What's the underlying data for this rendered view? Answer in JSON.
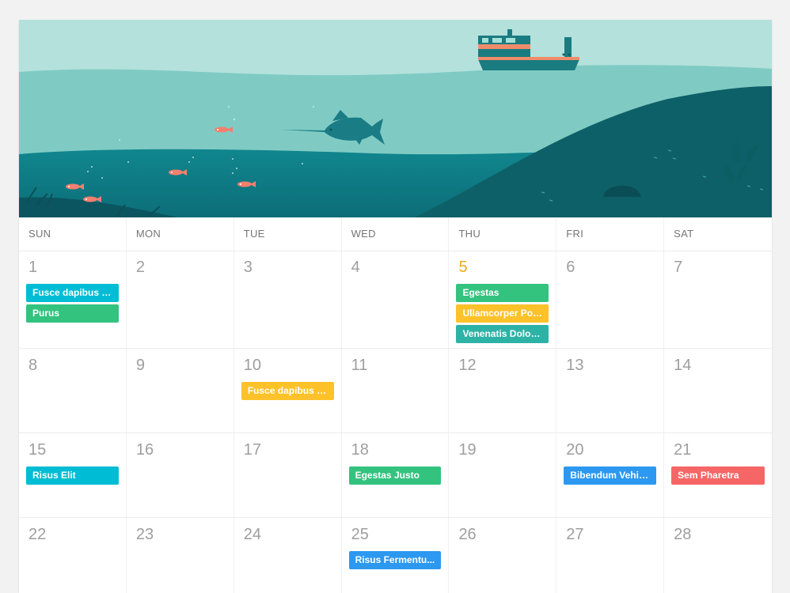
{
  "weekdays": [
    "SUN",
    "MON",
    "TUE",
    "WED",
    "THU",
    "FRI",
    "SAT"
  ],
  "colors": {
    "cyan": "#00bcd4",
    "green": "#33c37f",
    "yellow": "#fdc22a",
    "teal": "#2db3a6",
    "blue": "#2c98f0",
    "red": "#f66666",
    "today": "#f6a623"
  },
  "weeks": [
    {
      "days": [
        {
          "num": "1",
          "events": [
            {
              "title": "Fusce dapibus t...",
              "color": "#00bcd4"
            },
            {
              "title": "Purus",
              "color": "#33c37f"
            }
          ]
        },
        {
          "num": "2",
          "events": []
        },
        {
          "num": "3",
          "events": []
        },
        {
          "num": "4",
          "events": []
        },
        {
          "num": "5",
          "today": true,
          "events": [
            {
              "title": "Egestas",
              "color": "#33c37f"
            },
            {
              "title": "Ullamcorper Por...",
              "color": "#fdc22a"
            },
            {
              "title": "Venenatis Dolor ...",
              "color": "#2db3a6"
            }
          ]
        },
        {
          "num": "6",
          "events": []
        },
        {
          "num": "7",
          "events": []
        }
      ]
    },
    {
      "days": [
        {
          "num": "8",
          "events": []
        },
        {
          "num": "9",
          "events": []
        },
        {
          "num": "10",
          "events": [
            {
              "title": "Fusce dapibus t...",
              "color": "#fdc22a"
            }
          ]
        },
        {
          "num": "11",
          "events": []
        },
        {
          "num": "12",
          "events": []
        },
        {
          "num": "13",
          "events": []
        },
        {
          "num": "14",
          "events": []
        }
      ]
    },
    {
      "days": [
        {
          "num": "15",
          "events": [
            {
              "title": "Risus Elit",
              "color": "#00bcd4"
            }
          ]
        },
        {
          "num": "16",
          "events": []
        },
        {
          "num": "17",
          "events": []
        },
        {
          "num": "18",
          "events": [
            {
              "title": "Egestas Justo",
              "color": "#33c37f"
            }
          ]
        },
        {
          "num": "19",
          "events": []
        },
        {
          "num": "20",
          "events": [
            {
              "title": "Bibendum Vehic...",
              "color": "#2c98f0"
            }
          ]
        },
        {
          "num": "21",
          "events": [
            {
              "title": "Sem Pharetra",
              "color": "#f66666"
            }
          ]
        }
      ]
    },
    {
      "days": [
        {
          "num": "22",
          "events": []
        },
        {
          "num": "23",
          "events": []
        },
        {
          "num": "24",
          "events": []
        },
        {
          "num": "25",
          "events": [
            {
              "title": "Risus Fermentu...",
              "color": "#2c98f0"
            }
          ]
        },
        {
          "num": "26",
          "events": []
        },
        {
          "num": "27",
          "events": []
        },
        {
          "num": "28",
          "events": []
        }
      ]
    }
  ]
}
